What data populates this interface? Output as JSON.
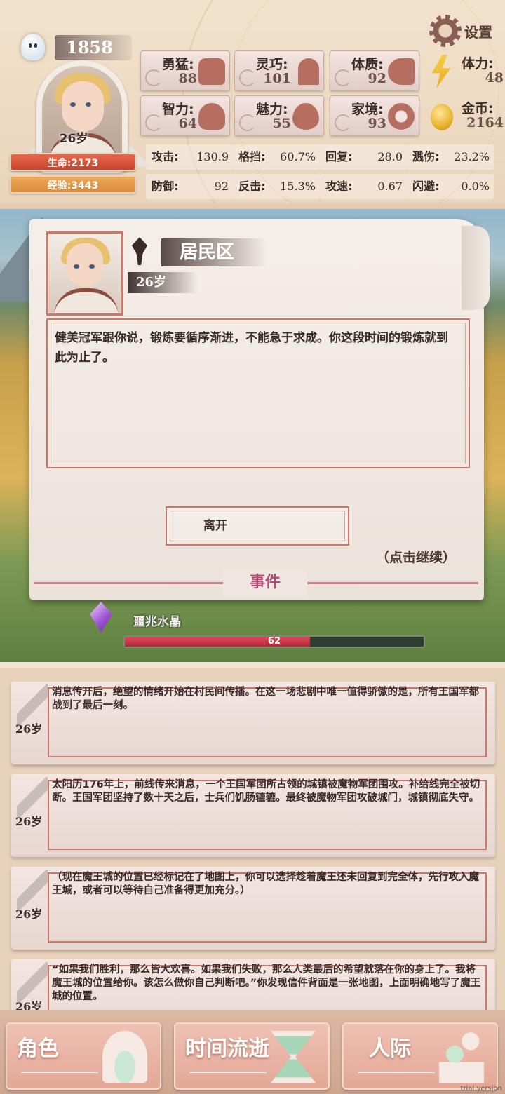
{
  "header": {
    "score": "1858",
    "age": "26岁",
    "hp_label": "生命:2173",
    "xp_label": "经验:3443",
    "settings_label": "设置"
  },
  "attributes": [
    {
      "label": "勇猛:",
      "value": "88",
      "icon": "fist-icon"
    },
    {
      "label": "灵巧:",
      "value": "101",
      "icon": "hand-icon"
    },
    {
      "label": "体质:",
      "value": "92",
      "icon": "arm-icon"
    },
    {
      "label": "智力:",
      "value": "64",
      "icon": "brain-head-icon"
    },
    {
      "label": "魅力:",
      "value": "55",
      "icon": "flower-icon"
    },
    {
      "label": "家境:",
      "value": "93",
      "icon": "coin-hand-icon"
    }
  ],
  "resources": {
    "stamina": {
      "label": "体力:",
      "value": "48",
      "icon": "lightning-icon"
    },
    "gold": {
      "label": "金币:",
      "value": "2164",
      "icon": "coin-icon"
    }
  },
  "stats": [
    {
      "label": "攻击:",
      "value": "130.9"
    },
    {
      "label": "格挡:",
      "value": "60.7%"
    },
    {
      "label": "回复:",
      "value": "28.0"
    },
    {
      "label": "溅伤:",
      "value": "23.2%"
    },
    {
      "label": "防御:",
      "value": "92"
    },
    {
      "label": "反击:",
      "value": "15.3%"
    },
    {
      "label": "攻速:",
      "value": "0.67"
    },
    {
      "label": "闪避:",
      "value": "0.0%"
    }
  ],
  "dialog": {
    "location": "居民区",
    "age": "26岁",
    "text": "健美冠军跟你说，锻炼要循序渐进，不能急于求成。你这段时间的锻炼就到此为止了。",
    "leave_button": "离开",
    "continue_hint": "（点击继续）",
    "section_label": "事件"
  },
  "crystal": {
    "name": "噩兆水晶",
    "value": "62",
    "fill_fraction": 0.62
  },
  "log": [
    {
      "age": "26岁",
      "text": "消息传开后，绝望的情绪开始在村民间传播。在这一场悲剧中唯一值得骄傲的是，所有王国军都战到了最后一刻。"
    },
    {
      "age": "26岁",
      "text": "太阳历176年上，前线传来消息，一个王国军团所占领的城镇被魔物军团围攻。补给线完全被切断。王国军团坚持了数十天之后，士兵们饥肠辘辘。最终被魔物军团攻破城门，城镇彻底失守。"
    },
    {
      "age": "26岁",
      "text": "（现在魔王城的位置已经标记在了地图上，你可以选择趁着魔王还未回复到完全体，先行攻入魔王城，或者可以等待自己准备得更加充分。）"
    },
    {
      "age": "26岁",
      "text": "“如果我们胜利，那么皆大欢喜。如果我们失败，那么人类最后的希望就落在你的身上了。我将魔王城的位置给你。该怎么做你自己判断吧。”你发现信件背面是一张地图，上面明确地写了魔王城的位置。"
    }
  ],
  "nav": {
    "role": "角色",
    "time": "时间流逝",
    "social": "人际"
  },
  "watermark": "trial version"
}
